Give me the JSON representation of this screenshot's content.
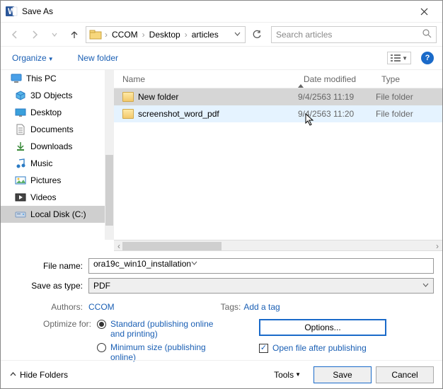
{
  "window": {
    "title": "Save As"
  },
  "nav": {
    "crumbs": [
      "CCOM",
      "Desktop",
      "articles"
    ],
    "search_placeholder": "Search articles"
  },
  "toolbar": {
    "organize": "Organize",
    "new_folder": "New folder"
  },
  "tree": {
    "this_pc": "This PC",
    "items": [
      {
        "key": "3d",
        "label": "3D Objects"
      },
      {
        "key": "desktop",
        "label": "Desktop"
      },
      {
        "key": "documents",
        "label": "Documents"
      },
      {
        "key": "downloads",
        "label": "Downloads"
      },
      {
        "key": "music",
        "label": "Music"
      },
      {
        "key": "pictures",
        "label": "Pictures"
      },
      {
        "key": "videos",
        "label": "Videos"
      },
      {
        "key": "localdisk",
        "label": "Local Disk (C:)"
      }
    ]
  },
  "columns": {
    "name": "Name",
    "date": "Date modified",
    "type": "Type"
  },
  "files": [
    {
      "name": "New folder",
      "date": "9/4/2563 11:19",
      "type": "File folder"
    },
    {
      "name": "screenshot_word_pdf",
      "date": "9/4/2563 11:20",
      "type": "File folder"
    }
  ],
  "fields": {
    "filename_label": "File name:",
    "filename_value": "ora19c_win10_installation",
    "saveas_label": "Save as type:",
    "saveas_value": "PDF"
  },
  "metadata": {
    "authors_label": "Authors:",
    "authors_value": "CCOM",
    "tags_label": "Tags:",
    "tags_value": "Add a tag"
  },
  "optimize": {
    "label": "Optimize for:",
    "standard": "Standard (publishing online and printing)",
    "minimum": "Minimum size (publishing online)"
  },
  "options": {
    "button": "Options...",
    "open_after": "Open file after publishing"
  },
  "footer": {
    "hide_folders": "Hide Folders",
    "tools": "Tools",
    "save": "Save",
    "cancel": "Cancel"
  }
}
